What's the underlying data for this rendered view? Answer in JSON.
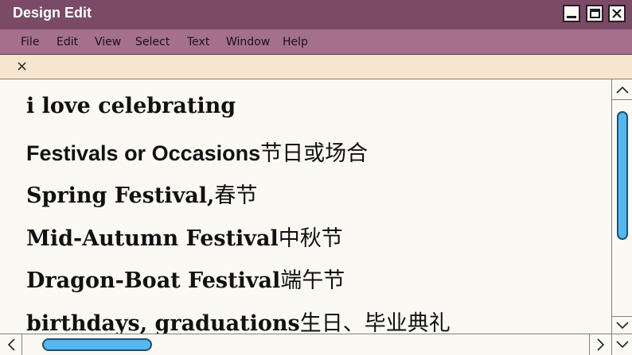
{
  "window": {
    "title": "Design Edit",
    "controls": {
      "minimize": "minimize-icon",
      "maximize": "maximize-icon",
      "close": "close-icon"
    }
  },
  "menubar": {
    "items": [
      "File",
      "Edit",
      "View",
      "Select",
      "Text",
      "Window",
      "Help"
    ]
  },
  "tab": {
    "close_glyph": "×"
  },
  "document": {
    "lines": [
      {
        "en": "i love celebrating",
        "cn": ""
      },
      {
        "en": "Festivals or Occasions",
        "cn": "节日或场合"
      },
      {
        "en": "Spring Festival,",
        "cn": "春节"
      },
      {
        "en": "Mid-Autumn Festival",
        "cn": "中秋节"
      },
      {
        "en": "Dragon-Boat Festival",
        "cn": "端午节"
      },
      {
        "en": "birthdays, graduations",
        "cn": "生日、毕业典礼"
      }
    ]
  },
  "colors": {
    "titlebar": "#7a4a66",
    "menubar": "#a4708d",
    "tabbar": "#f7e6cf",
    "scroll_thumb": "#56b7ee"
  }
}
